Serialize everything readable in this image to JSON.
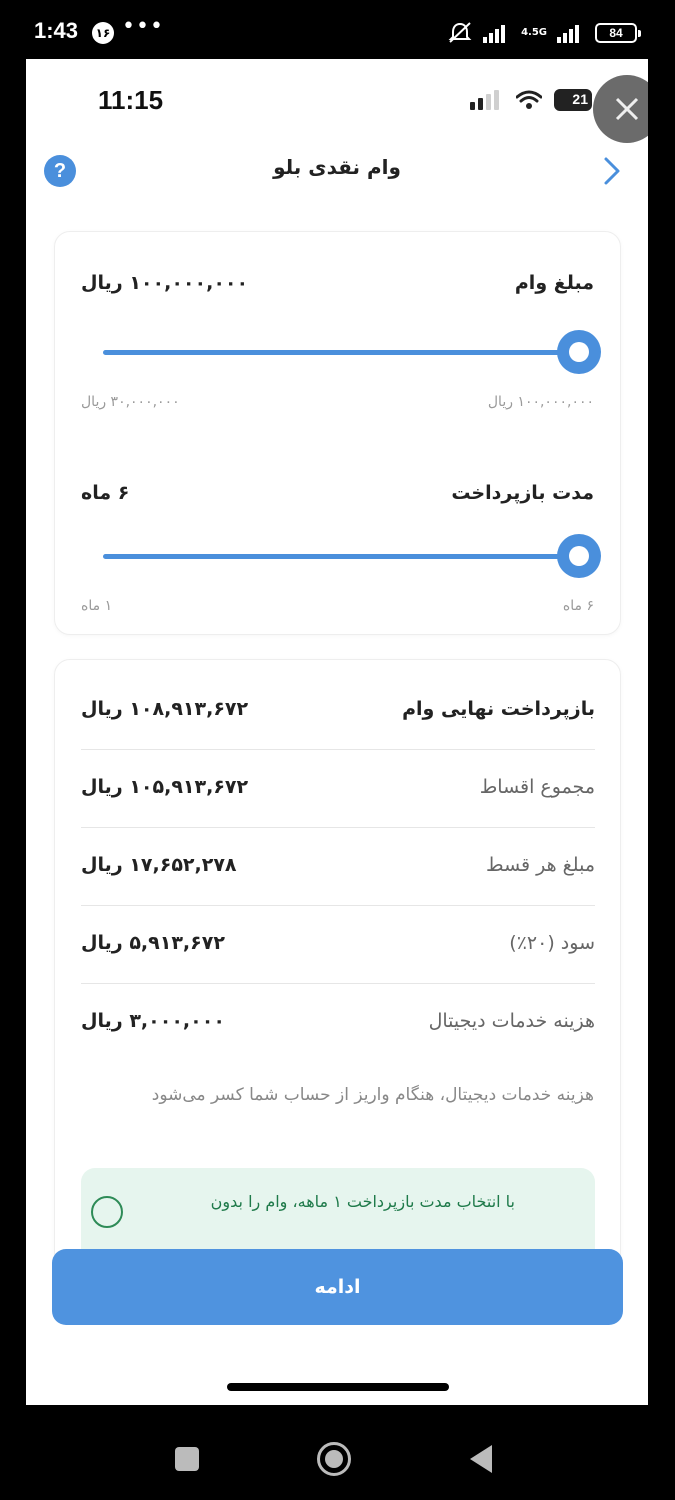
{
  "os_status": {
    "time": "1:43",
    "notification_badge": "۱۶",
    "dots": "•••",
    "network_type": "4.5G",
    "battery": "84"
  },
  "inner_status": {
    "time": "11:15",
    "battery": "21"
  },
  "header": {
    "title": "وام نقدی بلو",
    "help_icon": "question-icon",
    "back_icon": "chevron-right-icon"
  },
  "loan_amount": {
    "label": "مبلغ وام",
    "value": "۱۰۰,۰۰۰,۰۰۰ ریال",
    "min_label": "۳۰,۰۰۰,۰۰۰ ریال",
    "max_label": "۱۰۰,۰۰۰,۰۰۰ ریال",
    "level": 1.0
  },
  "repayment_period": {
    "label": "مدت بازپرداخت",
    "value": "۶ ماه",
    "min_label": "۱ ماه",
    "max_label": "۶ ماه",
    "level": 1.0
  },
  "summary": [
    {
      "label": "بازپرداخت نهایی وام",
      "value": "۱۰۸,۹۱۳,۶۷۲ ریال"
    },
    {
      "label": "مجموع اقساط",
      "value": "۱۰۵,۹۱۳,۶۷۲ ریال"
    },
    {
      "label": "مبلغ هر قسط",
      "value": "۱۷,۶۵۲,۲۷۸ ریال"
    },
    {
      "label": "سود (۲۰٪)",
      "value": "۵,۹۱۳,۶۷۲ ریال"
    },
    {
      "label": "هزینه خدمات دیجیتال",
      "value": "۳,۰۰۰,۰۰۰ ریال"
    }
  ],
  "note": "هزینه خدمات دیجیتال، هنگام واریز از حساب شما کسر می‌شود",
  "info_box": {
    "text": "با انتخاب مدت بازپرداخت ۱ ماهه، وام را بدون",
    "icon": "check-circle-icon"
  },
  "continue_label": "ادامه",
  "colors": {
    "accent": "#4a8fdc",
    "info_bg": "#e6f5ee",
    "info_text": "#1f7a4a"
  }
}
